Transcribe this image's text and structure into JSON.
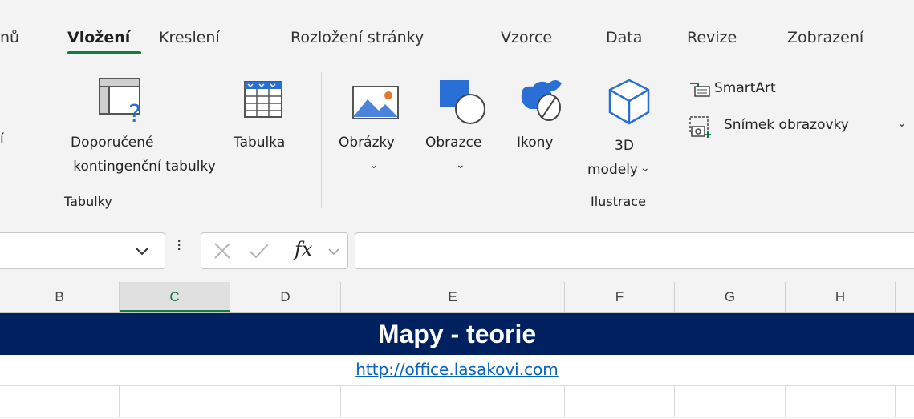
{
  "tabs": {
    "items": [
      "nů",
      "Vložení",
      "Kreslení",
      "Rozložení stránky",
      "Vzorce",
      "Data",
      "Revize",
      "Zobrazení"
    ],
    "active": "Vložení"
  },
  "ribbon": {
    "partial_label": "í",
    "recommended_pivot": {
      "line1": "Doporučené",
      "line2": "kontingenční tabulky"
    },
    "table": "Tabulka",
    "group_tables": "Tabulky",
    "pictures": "Obrázky",
    "shapes": "Obrazce",
    "icons": "Ikony",
    "models3d": {
      "line1": "3D",
      "line2": "modely"
    },
    "smartart": "SmartArt",
    "screenshot": "Snímek obrazovky",
    "group_illustrations": "Ilustrace"
  },
  "formula_bar": {
    "name_box_value": "",
    "fx": "fx",
    "formula_value": ""
  },
  "columns": [
    "B",
    "C",
    "D",
    "E",
    "F",
    "G",
    "H"
  ],
  "selected_column": "C",
  "sheet": {
    "title": "Mapy - teorie",
    "link": "http://office.lasakovi.com"
  },
  "colors": {
    "accent": "#107c41",
    "title_fill": "#002060",
    "link": "#0563c1"
  }
}
